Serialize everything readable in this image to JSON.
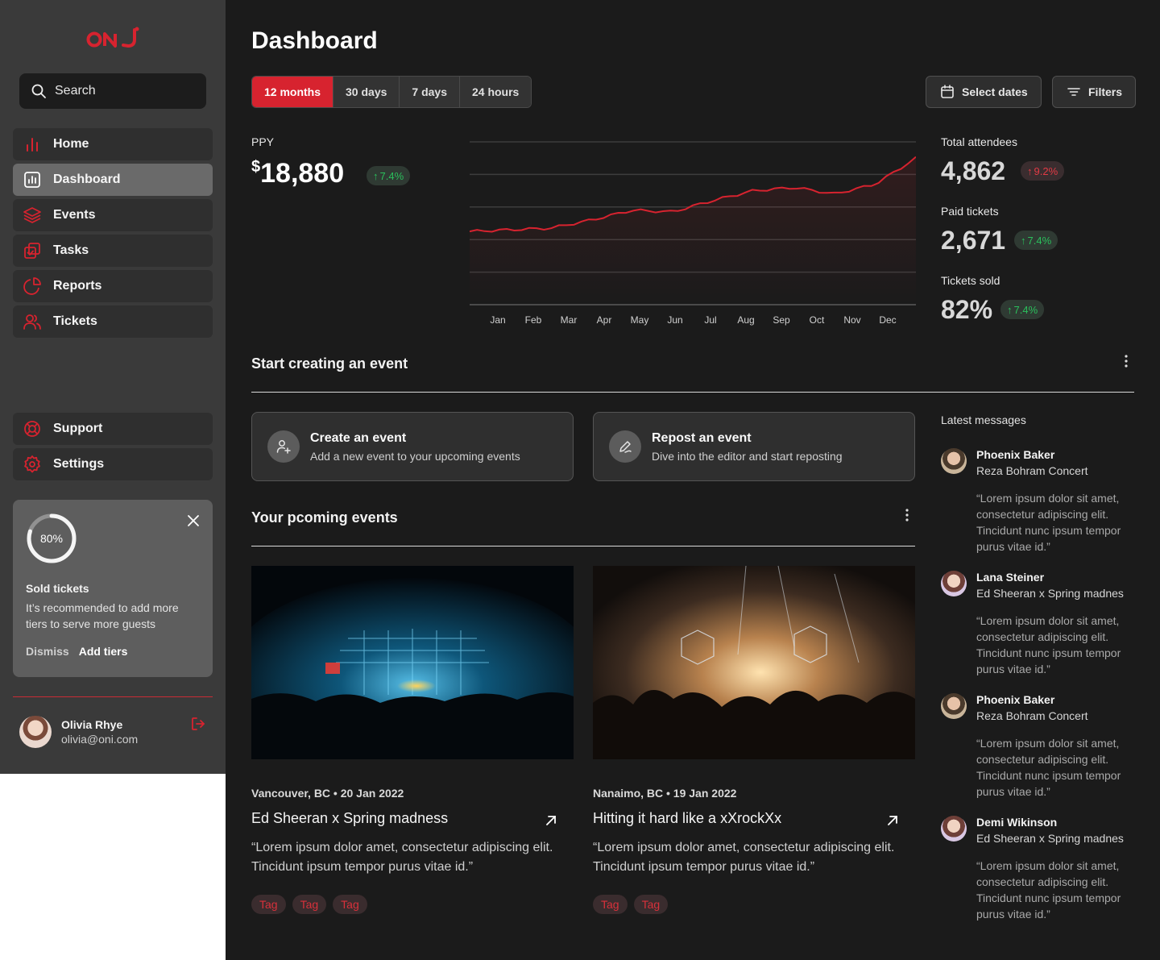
{
  "brand": {
    "logo_text": "ONJ",
    "accent": "#d7232f"
  },
  "sidebar": {
    "search_label": "Search",
    "items": [
      {
        "label": "Home",
        "icon": "bar-chart-icon"
      },
      {
        "label": "Dashboard",
        "icon": "dashboard-icon"
      },
      {
        "label": "Events",
        "icon": "layers-icon"
      },
      {
        "label": "Tasks",
        "icon": "check-square-icon"
      },
      {
        "label": "Reports",
        "icon": "pie-chart-icon"
      },
      {
        "label": "Tickets",
        "icon": "users-icon"
      }
    ],
    "footer_items": [
      {
        "label": "Support",
        "icon": "lifebuoy-icon"
      },
      {
        "label": "Settings",
        "icon": "gear-icon"
      }
    ],
    "promo": {
      "progress_label": "80%",
      "progress": 0.8,
      "title": "Sold tickets",
      "text": "It’s recommended to add more tiers to serve more guests",
      "dismiss": "Dismiss",
      "action": "Add tiers"
    },
    "user": {
      "name": "Olivia Rhye",
      "email": "olivia@oni.com"
    }
  },
  "header": {
    "title": "Dashboard",
    "ranges": [
      "12 months",
      "30 days",
      "7 days",
      "24 hours"
    ],
    "selected_range": "12 months",
    "select_dates": "Select dates",
    "filters": "Filters"
  },
  "ppy": {
    "label": "PPY",
    "currency": "$",
    "value": "18,880",
    "change": "7.4%"
  },
  "stats": [
    {
      "label": "Total attendees",
      "value": "4,862",
      "change": "9.2%",
      "trend": "up-red"
    },
    {
      "label": "Paid tickets",
      "value": "2,671",
      "change": "7.4%",
      "trend": "up"
    },
    {
      "label": "Tickets sold",
      "value": "82%",
      "change": "7.4%",
      "trend": "up"
    }
  ],
  "chart_data": {
    "type": "area",
    "categories": [
      "Jan",
      "Feb",
      "Mar",
      "Apr",
      "May",
      "Jun",
      "Jul",
      "Aug",
      "Sep",
      "Oct",
      "Nov",
      "Dec"
    ],
    "values": [
      0.45,
      0.46,
      0.47,
      0.52,
      0.58,
      0.57,
      0.64,
      0.7,
      0.72,
      0.68,
      0.74,
      0.9
    ],
    "ylim": [
      0,
      1
    ],
    "grid": true,
    "line_color": "#d7232f"
  },
  "create": {
    "title": "Start creating an event",
    "cards": [
      {
        "title": "Create an event",
        "subtitle": "Add a new event to your upcoming events",
        "icon": "user-plus-icon"
      },
      {
        "title": "Repost an event",
        "subtitle": "Dive into the editor and start reposting",
        "icon": "pen-icon"
      }
    ]
  },
  "upcoming": {
    "title": "Your pcoming events",
    "events": [
      {
        "meta": "Vancouver, BC • 20 Jan 2022",
        "title": "Ed Sheeran x Spring madness",
        "desc": "“Lorem ipsum dolor  amet, consectetur adipiscing elit. Tincidunt ipsum tempor purus vitae id.”",
        "tags": [
          "Tag",
          "Tag",
          "Tag"
        ]
      },
      {
        "meta": "Nanaimo, BC • 19 Jan 2022",
        "title": "Hitting it hard like a xXrockXx",
        "desc": "“Lorem ipsum dolor  amet, consectetur adipiscing elit. Tincidunt ipsum tempor purus vitae id.”",
        "tags": [
          "Tag",
          "Tag"
        ]
      }
    ]
  },
  "messages": {
    "label": "Latest messages",
    "items": [
      {
        "name": "Phoenix Baker",
        "subject": "Reza Bohram Concert",
        "text": "“Lorem ipsum dolor sit amet, consectetur adipiscing elit. Tincidunt nunc ipsum tempor purus vitae id.”"
      },
      {
        "name": "Lana Steiner",
        "subject": "Ed Sheeran x Spring madnes",
        "text": "“Lorem ipsum dolor sit amet, consectetur adipiscing elit. Tincidunt nunc ipsum tempor purus vitae id.”"
      },
      {
        "name": "Phoenix Baker",
        "subject": "Reza Bohram Concert",
        "text": "“Lorem ipsum dolor sit amet, consectetur adipiscing elit. Tincidunt nunc ipsum tempor purus vitae id.”"
      },
      {
        "name": "Demi Wikinson",
        "subject": "Ed Sheeran x Spring madnes",
        "text": "“Lorem ipsum dolor sit amet, consectetur adipiscing elit. Tincidunt nunc ipsum tempor purus vitae id.”"
      }
    ]
  }
}
